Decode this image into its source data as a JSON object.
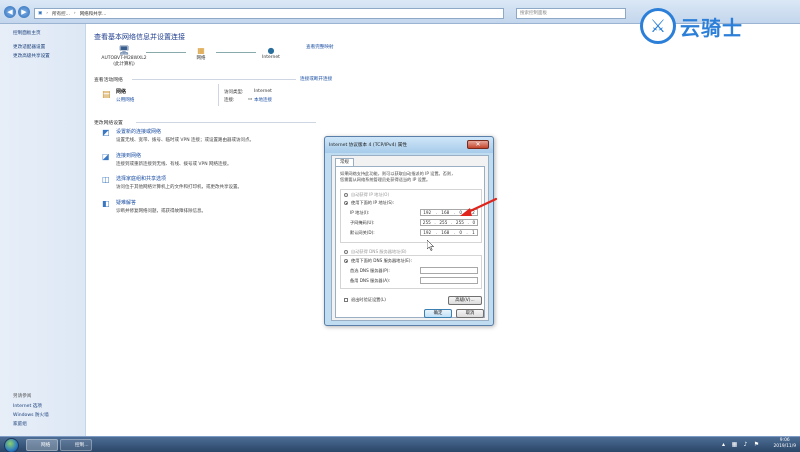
{
  "addressbar": {
    "crumbs": [
      "所有控...",
      "网络和共享..."
    ],
    "search_placeholder": "搜索控制面板"
  },
  "watermark": {
    "text": "云骑士"
  },
  "leftpane": {
    "top_links": [
      "控制面板主页",
      "更改适配器设置",
      "更改高级共享设置"
    ],
    "see_also_header": "另请参阅",
    "bottom_links": [
      "Internet 选项",
      "Windows 防火墙",
      "家庭组"
    ]
  },
  "main": {
    "title": "查看基本网络信息并设置连接",
    "full_map": "查看完整映射",
    "map": {
      "computer_name": "AUTOBVT-M28WXL2",
      "computer_sub": "(此计算机)",
      "network": "网络",
      "internet": "Internet"
    },
    "active_header": "查看活动网络",
    "connect_link": "连接或断开连接",
    "network_name": "网络",
    "network_type": "公用网络",
    "access_type_label": "访问类型:",
    "access_type_value": "Internet",
    "connections_label": "连接:",
    "connections_value": "本地连接",
    "change_header": "更改网络设置",
    "tasks": [
      {
        "title": "设置新的连接或网络",
        "desc": "设置无线、宽带、拨号、临时或 VPN 连接；或设置路由器或访问点。"
      },
      {
        "title": "连接到网络",
        "desc": "连接到或重新连接到无线、有线、拨号或 VPN 网络连接。"
      },
      {
        "title": "选择家庭组和共享选项",
        "desc": "访问位于其他网络计算机上的文件和打印机，或更改共享设置。"
      },
      {
        "title": "疑难解答",
        "desc": "诊断并修复网络问题，或获得故障排除信息。"
      }
    ]
  },
  "dialog": {
    "title": "Internet 协议版本 4 (TCP/IPv4) 属性",
    "tab": "常规",
    "intro_line1": "如果网络支持此功能，则可以获取自动指派的 IP 设置。否则，",
    "intro_line2": "您需要从网络系统管理员处获得适当的 IP 设置。",
    "auto_ip": "自动获得 IP 地址(O)",
    "manual_ip": "使用下面的 IP 地址(S):",
    "ip_label": "IP 地址(I):",
    "ip_value": [
      "192",
      "168",
      "0",
      "2"
    ],
    "mask_label": "子网掩码(U):",
    "mask_value": [
      "255",
      "255",
      "255",
      "0"
    ],
    "gateway_label": "默认网关(D):",
    "gateway_value": [
      "192",
      "168",
      "0",
      "1"
    ],
    "auto_dns": "自动获得 DNS 服务器地址(B)",
    "manual_dns": "使用下面的 DNS 服务器地址(E):",
    "dns1_label": "首选 DNS 服务器(P):",
    "dns2_label": "备用 DNS 服务器(A):",
    "validate": "退出时验证设置(L)",
    "advanced": "高级(V)...",
    "ok": "确定",
    "cancel": "取消"
  },
  "taskbar": {
    "items": [
      "网络",
      "控制..."
    ],
    "time": "9:06",
    "date": "2019/11/9"
  },
  "colors": {
    "link": "#1a4ea3",
    "arrow": "#e0241b",
    "title": "#1e3d8f"
  }
}
